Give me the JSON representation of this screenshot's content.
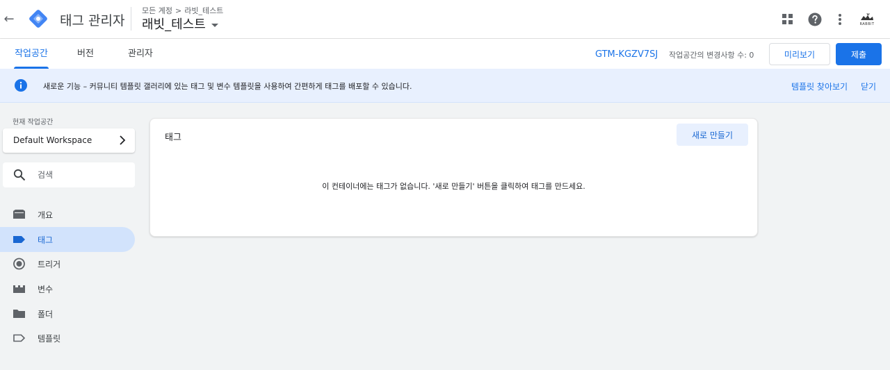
{
  "header": {
    "app_title": "태그 관리자",
    "breadcrumb": [
      "모든 계정",
      "라빗_테스트"
    ],
    "breadcrumb_sep": ">",
    "container_name": "래빗_테스트",
    "avatar_text": "RABBIT"
  },
  "subnav": {
    "tabs": [
      {
        "label": "작업공간",
        "active": true
      },
      {
        "label": "버전",
        "active": false
      },
      {
        "label": "관리자",
        "active": false
      }
    ],
    "container_id": "GTM-KGZV7SJ",
    "changes_text": "작업공간의 변경사항 수: 0",
    "preview_label": "미리보기",
    "submit_label": "제출"
  },
  "banner": {
    "text": "새로운 기능 – 커뮤니티 템플릿 갤러리에 있는 태그 및 변수 템플릿을 사용하여 간편하게 태그를 배포할 수 있습니다.",
    "template_link": "템플릿 찾아보기",
    "close_link": "닫기"
  },
  "sidebar": {
    "workspace_label": "현재 작업공간",
    "workspace_name": "Default Workspace",
    "search_placeholder": "검색",
    "items": [
      {
        "label": "개요",
        "icon": "briefcase-icon"
      },
      {
        "label": "태그",
        "icon": "tag-icon",
        "active": true
      },
      {
        "label": "트리거",
        "icon": "trigger-icon"
      },
      {
        "label": "변수",
        "icon": "variable-icon"
      },
      {
        "label": "폴더",
        "icon": "folder-icon"
      },
      {
        "label": "템플릿",
        "icon": "template-icon"
      }
    ]
  },
  "main": {
    "card_title": "태그",
    "new_button": "새로 만들기",
    "empty_message": "이 컨테이너에는 태그가 없습니다. '새로 만들기' 버튼을 클릭하여 태그를 만드세요."
  },
  "colors": {
    "accent": "#1a73e8",
    "active_bg": "#d2e3fc",
    "banner_bg": "#e8f0fe",
    "page_bg": "#f1f3f4"
  }
}
